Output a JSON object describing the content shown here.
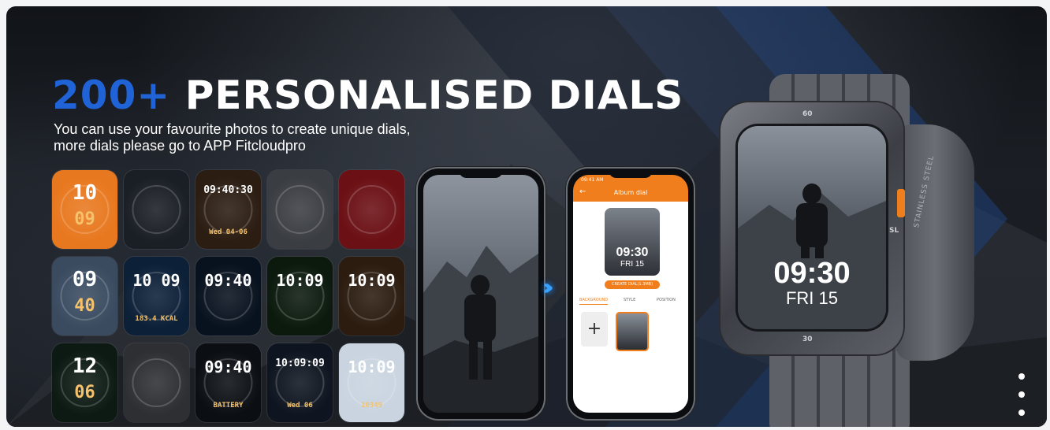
{
  "headline": {
    "number": "200+",
    "text": "PERSONALISED DIALS"
  },
  "subtitle": {
    "line1": "You can use your favourite photos to create unique dials,",
    "line2": "more dials please go to APP Fitcloudpro"
  },
  "dials": [
    {
      "name": "dial-orange-digital",
      "bg": "#e8781f",
      "main": "10",
      "sub": "09"
    },
    {
      "name": "dial-chrono-red-blue",
      "bg": "#1a1e25",
      "main": "",
      "sub": ""
    },
    {
      "name": "dial-gold-flower",
      "bg": "#2b1d12",
      "main": "09:40:30",
      "sub": "Wed 04-06"
    },
    {
      "name": "dial-skeleton-grey",
      "bg": "#3a3d42",
      "main": "",
      "sub": ""
    },
    {
      "name": "dial-red-mechanical",
      "bg": "#6b1015",
      "main": "",
      "sub": ""
    },
    {
      "name": "dial-astronaut",
      "bg": "#3a4b60",
      "main": "09",
      "sub": "40"
    },
    {
      "name": "dial-blue-body",
      "bg": "#0c2038",
      "main": "10 09",
      "sub": "183.4 KCAL"
    },
    {
      "name": "dial-planet",
      "bg": "#08121e",
      "main": "09:40",
      "sub": ""
    },
    {
      "name": "dial-green-gears",
      "bg": "#0c1a0e",
      "main": "10:09",
      "sub": ""
    },
    {
      "name": "dial-bronze-gears",
      "bg": "#2c1c10",
      "main": "10:09",
      "sub": ""
    },
    {
      "name": "dial-green-analog",
      "bg": "#0d1a14",
      "main": "12",
      "sub": "06"
    },
    {
      "name": "dial-steel-mechanical",
      "bg": "#2e2f33",
      "main": "",
      "sub": ""
    },
    {
      "name": "dial-orange-battery",
      "bg": "#0b0f14",
      "main": "09:40",
      "sub": "BATTERY"
    },
    {
      "name": "dial-sport-car",
      "bg": "#0f1520",
      "main": "10:09:09",
      "sub": "Wed 06"
    },
    {
      "name": "dial-astronaut-white",
      "bg": "#c9d4e0",
      "main": "10:09",
      "sub": "10349"
    }
  ],
  "phone_left": {
    "screen_color": "#6f757e"
  },
  "phone_right": {
    "status": "09:41 AM",
    "title": "Album dial",
    "preview_time": "09:30",
    "preview_date": "FRI  15",
    "create_button": "CREATE DIAL(1.3MB)",
    "tabs": [
      "BACKGROUND",
      "STYLE",
      "POSITION"
    ],
    "add_label": "+"
  },
  "watch": {
    "time": "09:30",
    "date": "FRI  15",
    "bezel_top": "60",
    "bezel_bottom": "30",
    "bezel_side": "SL",
    "side_text": "STAINLESS STEEL"
  },
  "colors": {
    "accent": "#f07e1c",
    "headline_blue": "#1f63d6"
  },
  "carousel": {
    "dots": 3
  }
}
